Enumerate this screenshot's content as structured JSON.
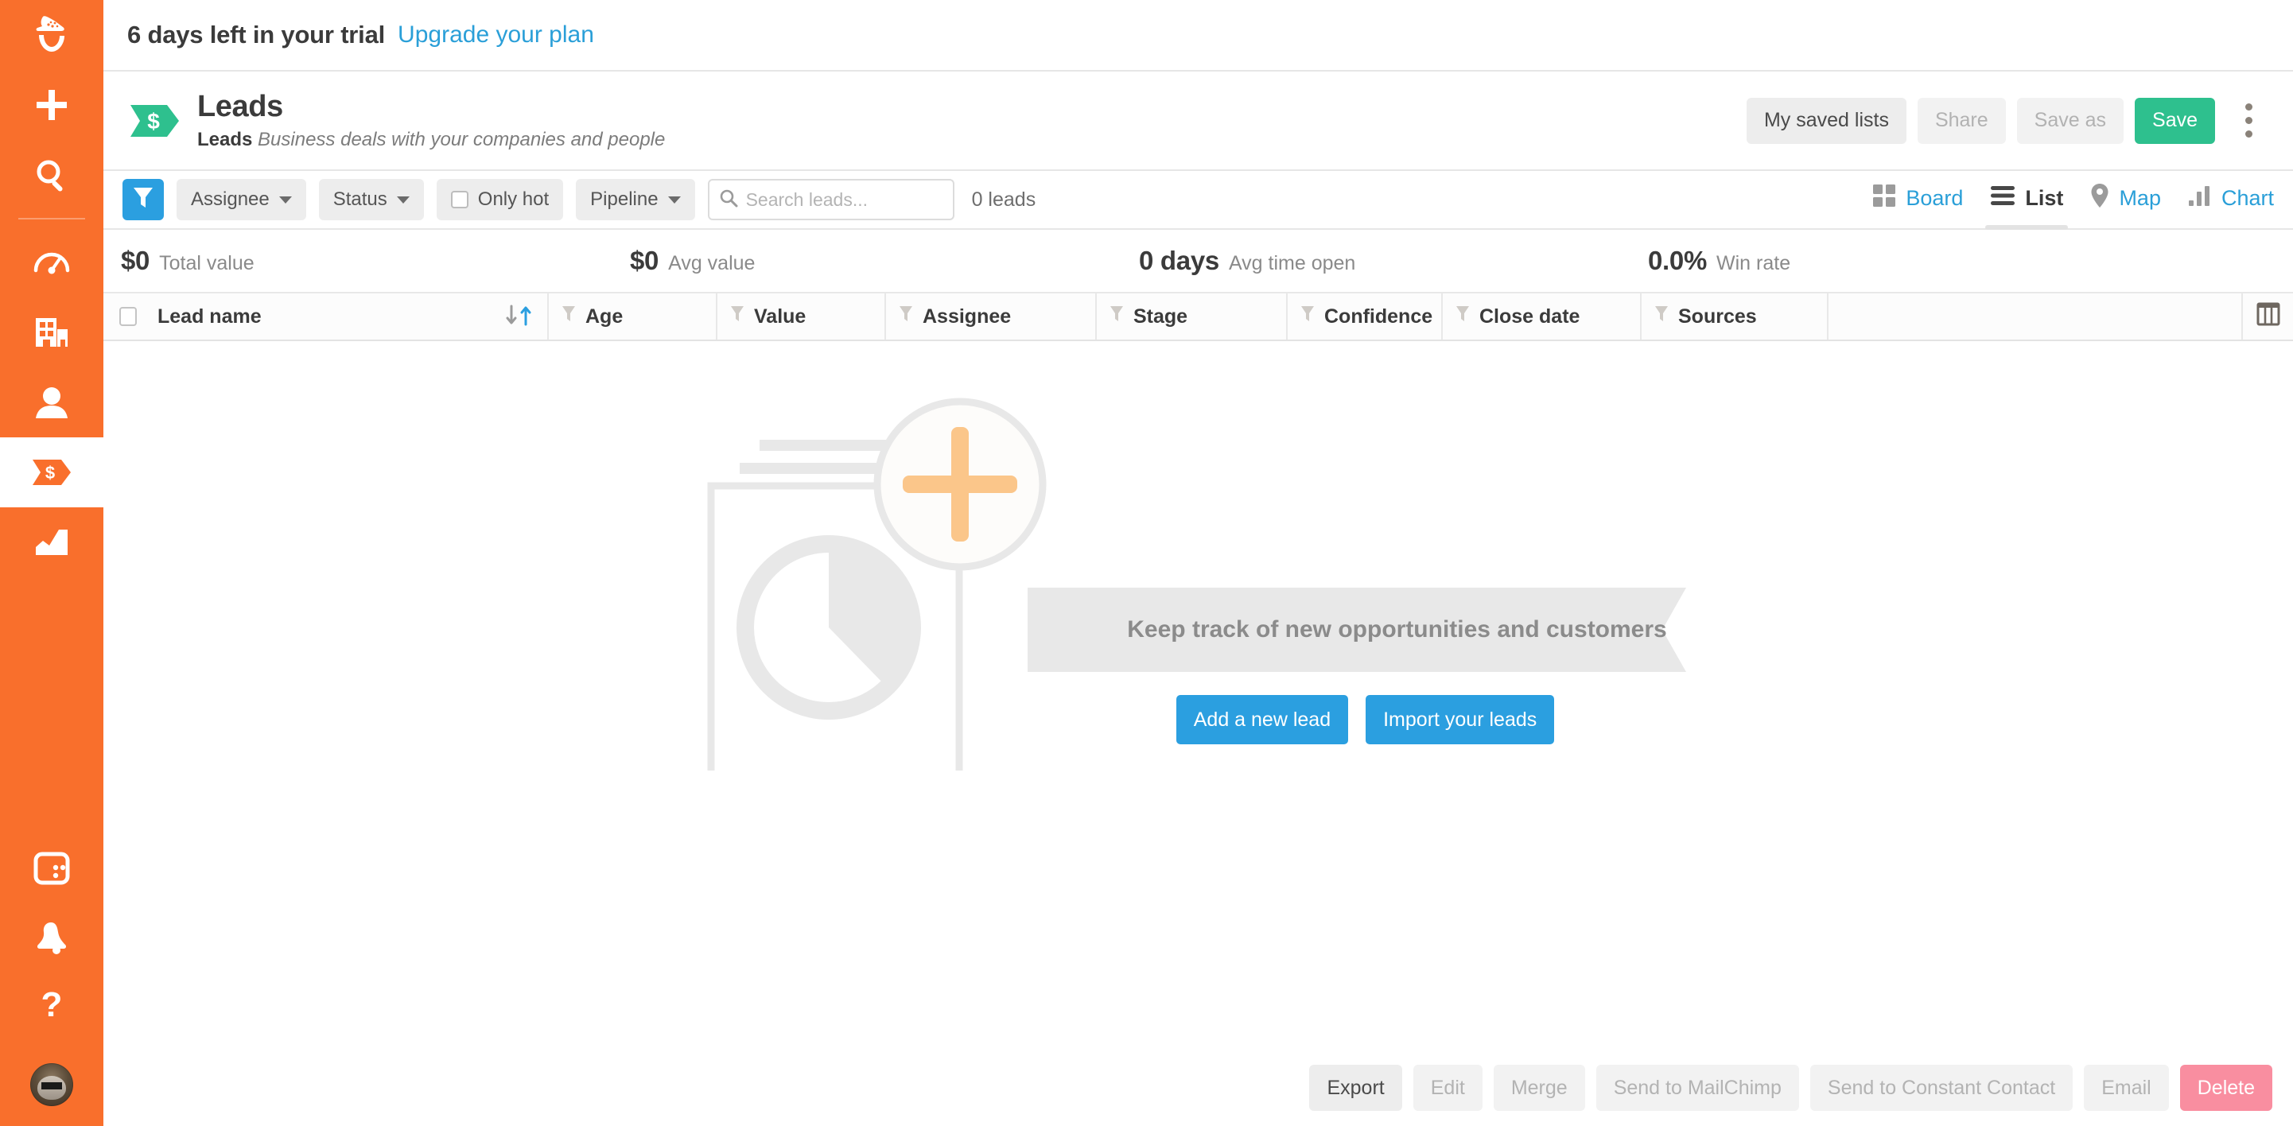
{
  "sidebar": {
    "items": [
      {
        "name": "logo-acorn",
        "label": "Nutshell"
      },
      {
        "name": "add",
        "label": "Add"
      },
      {
        "name": "search",
        "label": "Search"
      },
      {
        "name": "dashboard",
        "label": "Dashboard"
      },
      {
        "name": "companies",
        "label": "Companies"
      },
      {
        "name": "people",
        "label": "People"
      },
      {
        "name": "leads",
        "label": "Leads",
        "active": true
      },
      {
        "name": "reports",
        "label": "Reports"
      },
      {
        "name": "apps",
        "label": "Apps"
      },
      {
        "name": "notifications",
        "label": "Notifications"
      },
      {
        "name": "help",
        "label": "Help"
      },
      {
        "name": "account-avatar",
        "label": "My account"
      }
    ]
  },
  "trial": {
    "message": "6 days left in your trial",
    "link_label": "Upgrade your plan"
  },
  "header": {
    "icon": "leads-flag-icon",
    "icon_color": "#2ec08e",
    "title": "Leads",
    "subtitle_strong": "Leads",
    "subtitle_italic": "Business deals with your companies and people",
    "buttons": [
      {
        "label": "My saved lists",
        "state": "enabled"
      },
      {
        "label": "Share",
        "state": "disabled"
      },
      {
        "label": "Save as",
        "state": "disabled"
      },
      {
        "label": "Save",
        "state": "primary"
      }
    ],
    "overflow_menu": "kebab-menu"
  },
  "filters": {
    "funnel_icon": "filter-funnel-icon",
    "funnel_color": "#2b9fe0",
    "dropdowns": [
      {
        "label": "Assignee"
      },
      {
        "label": "Status"
      },
      {
        "label": "Pipeline"
      }
    ],
    "only_hot": {
      "label": "Only hot",
      "checked": false
    },
    "search": {
      "placeholder": "Search leads...",
      "value": ""
    },
    "count_label": "0 leads"
  },
  "views": [
    {
      "label": "Board",
      "icon": "grid-icon",
      "active": false
    },
    {
      "label": "List",
      "icon": "list-icon",
      "active": true
    },
    {
      "label": "Map",
      "icon": "map-pin-icon",
      "active": false
    },
    {
      "label": "Chart",
      "icon": "bar-chart-icon",
      "active": false
    }
  ],
  "stats": [
    {
      "value": "$0",
      "label": "Total value"
    },
    {
      "value": "$0",
      "label": "Avg value"
    },
    {
      "value": "0 days",
      "label": "Avg time open"
    },
    {
      "value": "0.0%",
      "label": "Win rate"
    }
  ],
  "table": {
    "select_all": false,
    "columns": [
      {
        "label": "Lead name",
        "sortable": true,
        "filterable": false
      },
      {
        "label": "Age",
        "filterable": true
      },
      {
        "label": "Value",
        "filterable": true
      },
      {
        "label": "Assignee",
        "filterable": true
      },
      {
        "label": "Stage",
        "filterable": true
      },
      {
        "label": "Confidence",
        "filterable": true
      },
      {
        "label": "Close date",
        "filterable": true
      },
      {
        "label": "Sources",
        "filterable": true
      }
    ],
    "column_chooser_icon": "columns-icon",
    "rows": []
  },
  "empty_state": {
    "illustration": "document-with-pie-chart-and-plus-icon",
    "ribbon_text": "Keep track of new opportunities and customers",
    "primary_cta": "Add a new lead",
    "secondary_cta": "Import your leads"
  },
  "bottom_actions": [
    {
      "label": "Export",
      "state": "enabled"
    },
    {
      "label": "Edit",
      "state": "disabled"
    },
    {
      "label": "Merge",
      "state": "disabled"
    },
    {
      "label": "Send to MailChimp",
      "state": "disabled"
    },
    {
      "label": "Send to Constant Contact",
      "state": "disabled"
    },
    {
      "label": "Email",
      "state": "disabled"
    },
    {
      "label": "Delete",
      "state": "danger"
    }
  ],
  "colors": {
    "sidebar": "#f96f2c",
    "accent_blue": "#2b9fe0",
    "green": "#2ec08e",
    "danger": "#f98ea0"
  }
}
